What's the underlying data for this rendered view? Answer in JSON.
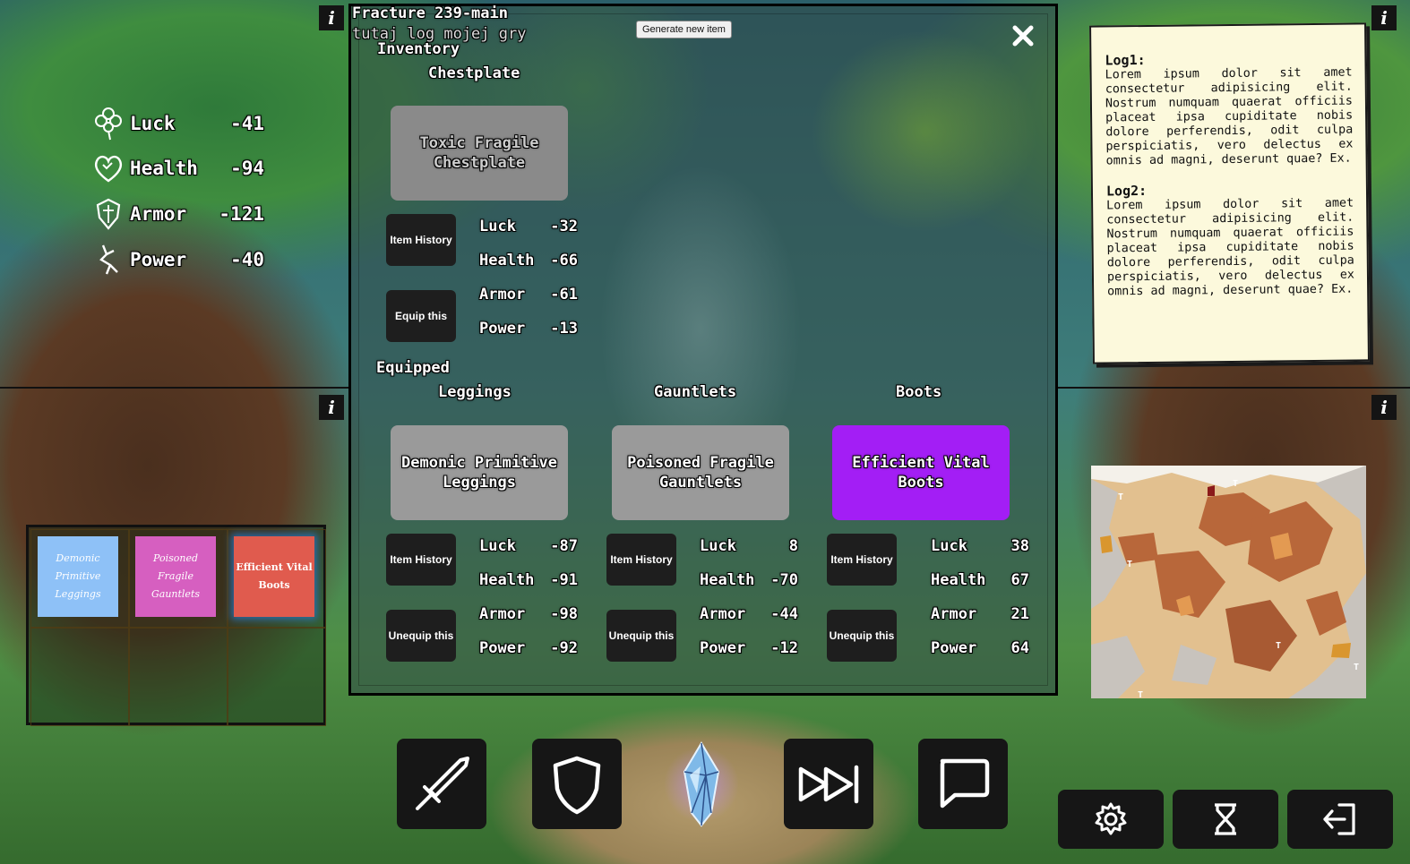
{
  "header": {
    "title": "Fracture 239-main",
    "subtitle": "tutaj log mojej gry",
    "generate_label": "Generate new item"
  },
  "player_stats": [
    {
      "icon": "clover-icon",
      "label": "Luck",
      "value": "-41"
    },
    {
      "icon": "heart-icon",
      "label": "Health",
      "value": "-94"
    },
    {
      "icon": "armor-icon",
      "label": "Armor",
      "value": "-121"
    },
    {
      "icon": "power-icon",
      "label": "Power",
      "value": "-40"
    }
  ],
  "inventory": {
    "heading": "Inventory",
    "slot": "Chestplate",
    "item": {
      "name": "Toxic Fragile Chestplate",
      "color": "#8a8a8a"
    },
    "history_label": "Item History",
    "action_label": "Equip this",
    "stats": [
      {
        "label": "Luck",
        "value": "-32"
      },
      {
        "label": "Health",
        "value": "-66"
      },
      {
        "label": "Armor",
        "value": "-61"
      },
      {
        "label": "Power",
        "value": "-13"
      }
    ]
  },
  "equipped": {
    "heading": "Equipped",
    "slots": [
      {
        "slot": "Leggings",
        "name": "Demonic Primitive Leggings",
        "color": "#9a9a9a",
        "history_label": "Item History",
        "action_label": "Unequip this",
        "stats": [
          {
            "label": "Luck",
            "value": "-87"
          },
          {
            "label": "Health",
            "value": "-91"
          },
          {
            "label": "Armor",
            "value": "-98"
          },
          {
            "label": "Power",
            "value": "-92"
          }
        ]
      },
      {
        "slot": "Gauntlets",
        "name": "Poisoned Fragile Gauntlets",
        "color": "#9a9a9a",
        "history_label": "Item History",
        "action_label": "Unequip this",
        "stats": [
          {
            "label": "Luck",
            "value": "8"
          },
          {
            "label": "Health",
            "value": "-70"
          },
          {
            "label": "Armor",
            "value": "-44"
          },
          {
            "label": "Power",
            "value": "-12"
          }
        ]
      },
      {
        "slot": "Boots",
        "name": "Efficient Vital Boots",
        "color": "#a31ef5",
        "history_label": "Item History",
        "action_label": "Unequip this",
        "stats": [
          {
            "label": "Luck",
            "value": "38"
          },
          {
            "label": "Health",
            "value": "67"
          },
          {
            "label": "Armor",
            "value": "21"
          },
          {
            "label": "Power",
            "value": "64"
          }
        ]
      }
    ]
  },
  "log": {
    "entries": [
      {
        "title": "Log1:",
        "text": "Lorem ipsum dolor sit amet consectetur adipisicing elit. Nostrum numquam quaerat officiis placeat ipsa cupiditate nobis dolore perferendis, odit culpa perspiciatis, vero delectus ex omnis ad magni, deserunt quae? Ex."
      },
      {
        "title": "Log2:",
        "text": "Lorem ipsum dolor sit amet consectetur adipisicing elit. Nostrum numquam quaerat officiis placeat ipsa cupiditate nobis dolore perferendis, odit culpa perspiciatis, vero delectus ex omnis ad magni, deserunt quae? Ex."
      }
    ]
  },
  "inventory_grid": [
    {
      "name": "Demonic Primitive Leggings",
      "color": "#8ec1f7"
    },
    {
      "name": "Poisoned Fragile Gauntlets",
      "color": "#d65fc0"
    },
    {
      "name": "Efficient Vital Boots",
      "color": "#e05b4e"
    }
  ],
  "map": {
    "marker": "T"
  },
  "info_label": "i",
  "action_bar": [
    "sword-icon",
    "shield-icon",
    "crystal-icon",
    "fast-forward-icon",
    "chat-icon"
  ],
  "system_bar": [
    "gear-icon",
    "hourglass-icon",
    "exit-icon"
  ]
}
